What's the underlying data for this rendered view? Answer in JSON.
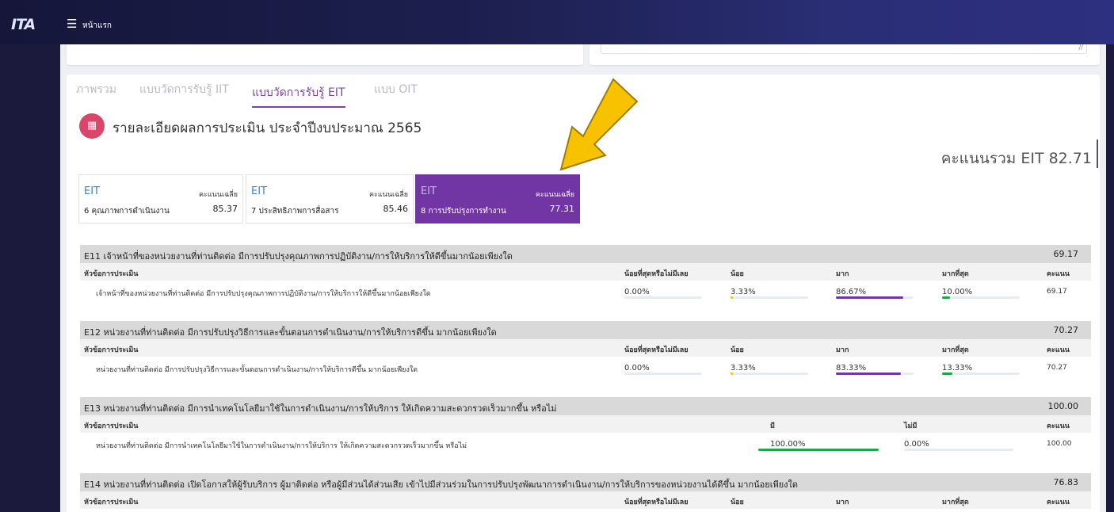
{
  "header": {
    "logo": "ITA",
    "breadcrumb": "หน้าแรก"
  },
  "tabs": [
    {
      "label": "ภาพรวม"
    },
    {
      "label": "แบบวัดการรับรู้ IIT"
    },
    {
      "label": "แบบวัดการรับรู้ EIT"
    },
    {
      "label": "แบบ OIT"
    }
  ],
  "report": {
    "title": "รายละเอียดผลการประเมิน ประจำปีงบประมาณ 2565",
    "total": "คะแนนรวม EIT 82.71"
  },
  "metrics": [
    {
      "code": "EIT",
      "avg_label": "คะแนนเฉลี่ย",
      "name": "6 คุณภาพการดำเนินงาน",
      "score": "85.37"
    },
    {
      "code": "EIT",
      "avg_label": "คะแนนเฉลี่ย",
      "name": "7 ประสิทธิภาพการสื่อสาร",
      "score": "85.46"
    },
    {
      "code": "EIT",
      "avg_label": "คะแนนเฉลี่ย",
      "name": "8 การปรับปรุงการทำงาน",
      "score": "77.31"
    }
  ],
  "sections": [
    {
      "title": "E11 เจ้าหน้าที่ของหน่วยงานที่ท่านติดต่อ มีการปรับปรุงคุณภาพการปฏิบัติงาน/การให้บริการให้ดีขึ้นมากน้อยเพียงใด",
      "score": "69.17",
      "columns": [
        "หัวข้อการประเมิน",
        "น้อยที่สุดหรือไม่มีเลย",
        "น้อย",
        "มาก",
        "มากที่สุด",
        "คะแนน"
      ],
      "row": {
        "label": "เจ้าหน้าที่ของหน่วยงานที่ท่านติดต่อ มีการปรับปรุงคุณภาพการปฏิบัติงาน/การให้บริการให้ดีขึ้นมากน้อยเพียงใด",
        "values": [
          "0.00%",
          "3.33%",
          "86.67%",
          "10.00%"
        ],
        "fractions": [
          0.0,
          0.0333,
          0.8667,
          0.1
        ],
        "score": "69.17"
      }
    },
    {
      "title": "E12 หน่วยงานที่ท่านติดต่อ มีการปรับปรุงวิธีการและขั้นตอนการดำเนินงาน/การให้บริการดีขึ้น มากน้อยเพียงใด",
      "score": "70.27",
      "columns": [
        "หัวข้อการประเมิน",
        "น้อยที่สุดหรือไม่มีเลย",
        "น้อย",
        "มาก",
        "มากที่สุด",
        "คะแนน"
      ],
      "row": {
        "label": "หน่วยงานที่ท่านติดต่อ มีการปรับปรุงวิธีการและขั้นตอนการดำเนินงาน/การให้บริการดีขึ้น มากน้อยเพียงใด",
        "values": [
          "0.00%",
          "3.33%",
          "83.33%",
          "13.33%"
        ],
        "fractions": [
          0.0,
          0.0333,
          0.8333,
          0.1333
        ],
        "score": "70.27"
      }
    },
    {
      "title": "E13 หน่วยงานที่ท่านติดต่อ มีการนำเทคโนโลยีมาใช้ในการดำเนินงาน/การให้บริการ ให้เกิดความสะดวกรวดเร็วมากขึ้น หรือไม่",
      "score": "100.00",
      "columns": [
        "หัวข้อการประเมิน",
        "มี",
        "ไม่มี",
        "คะแนน"
      ],
      "row": {
        "label": "หน่วยงานที่ท่านติดต่อ มีการนำเทคโนโลยีมาใช้ในการดำเนินงาน/การให้บริการ ให้เกิดความสะดวกรวดเร็วมากขึ้น หรือไม่",
        "values": [
          "100.00%",
          "0.00%"
        ],
        "fractions": [
          1.0,
          0.0
        ],
        "score": "100.00"
      }
    },
    {
      "title": "E14 หน่วยงานที่ท่านติดต่อ เปิดโอกาสให้ผู้รับบริการ ผู้มาติดต่อ หรือผู้มีส่วนได้ส่วนเสีย เข้าไปมีส่วนร่วมในการปรับปรุงพัฒนาการดำเนินงาน/การให้บริการของหน่วยงานได้ดีขึ้น มากน้อยเพียงใด",
      "score": "76.83",
      "columns": [
        "หัวข้อการประเมิน",
        "น้อยที่สุดหรือไม่มีเลย",
        "น้อย",
        "มาก",
        "มากที่สุด",
        "คะแนน"
      ]
    }
  ],
  "colors": {
    "accent": "#7236a4",
    "bar_low": "#f5c000",
    "bar_high": "#7236a4",
    "bar_top": "#1aa64a",
    "report_icon": "#d9466c",
    "arrow": "#f7c300"
  }
}
